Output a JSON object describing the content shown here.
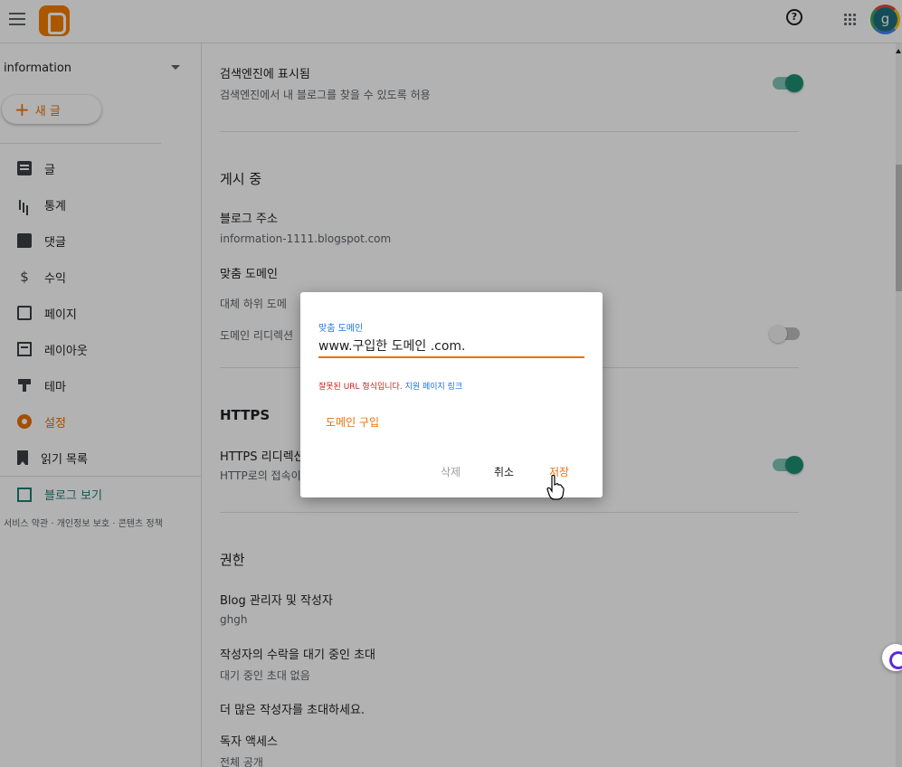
{
  "sidebar": {
    "blog_name": "information",
    "new_post": "새 글",
    "items": [
      {
        "label": "글",
        "icon": "post-icon"
      },
      {
        "label": "통계",
        "icon": "stats-icon"
      },
      {
        "label": "댓글",
        "icon": "comment-icon"
      },
      {
        "label": "수익",
        "icon": "dollar-icon"
      },
      {
        "label": "페이지",
        "icon": "pages-icon"
      },
      {
        "label": "레이아웃",
        "icon": "layout-icon"
      },
      {
        "label": "테마",
        "icon": "theme-icon"
      },
      {
        "label": "설정",
        "icon": "gear-icon",
        "active": true
      },
      {
        "label": "읽기 목록",
        "icon": "bookmark-icon"
      }
    ],
    "view_blog": "블로그 보기",
    "footer": "서비스 약관 · 개인정보 보호 · 콘텐츠 정책"
  },
  "main": {
    "search_visible_title": "검색엔진에 표시됨",
    "search_visible_sub": "검색엔진에서 내 블로그를 찾을 수 있도록 허용",
    "publishing_header": "게시 중",
    "blog_address_title": "블로그 주소",
    "blog_address_value": "information-1111.blogspot.com",
    "custom_domain_title": "맞춤 도메인",
    "fallback_sub": "대체 하위 도메",
    "domain_redirect": "도메인 리디렉션",
    "https_header": "HTTPS",
    "https_redirect_title": "HTTPS 리디렉션",
    "https_redirect_sub": "HTTP로의 접속이",
    "permissions_header": "권한",
    "admins_title": "Blog 관리자 및 작성자",
    "admins_value": "ghgh",
    "pending_title": "작성자의 수락을 대기 중인 초대",
    "pending_value": "대기 중인 초대 없음",
    "invite_more": "더 많은 작성자를 초대하세요.",
    "reader_access_title": "독자 액세스",
    "reader_access_value": "전체 공개"
  },
  "dialog": {
    "label": "맞춤 도메인",
    "input_value": "www.구입한 도메인 .com.",
    "error_text": "잘못된 URL 형식입니다.",
    "error_link": "지원 페이지 링크",
    "buy_domain": "도메인 구입",
    "delete": "삭제",
    "cancel": "취소",
    "save": "저장"
  },
  "header": {
    "help_icon": "?",
    "avatar_letter": "g"
  },
  "colors": {
    "accent": "#e8710a",
    "toggle": "#1e8e74",
    "link": "#1a73e8",
    "error": "#c5221f"
  }
}
